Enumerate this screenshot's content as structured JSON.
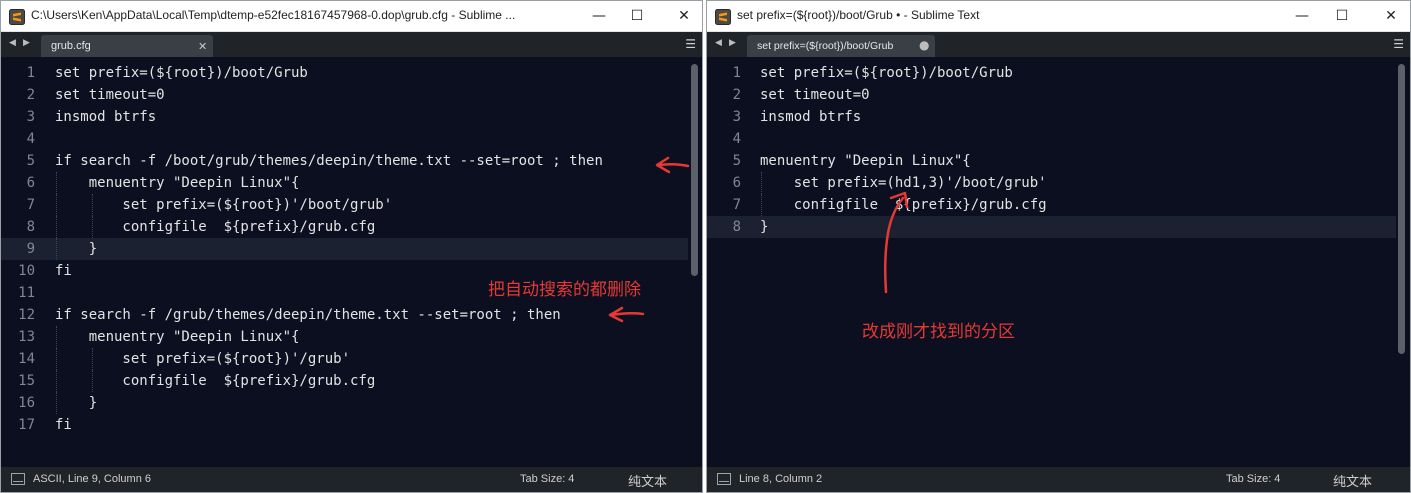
{
  "left_window": {
    "title": "C:\\Users\\Ken\\AppData\\Local\\Temp\\dtemp-e52fec18167457968-0.dop\\grub.cfg - Sublime ...",
    "tab_label": "grub.cfg",
    "lines": [
      {
        "num": "1",
        "text": "set prefix=(${root})/boot/Grub"
      },
      {
        "num": "2",
        "text": "set timeout=0"
      },
      {
        "num": "3",
        "text": "insmod btrfs"
      },
      {
        "num": "4",
        "text": ""
      },
      {
        "num": "5",
        "text": "if search -f /boot/grub/themes/deepin/theme.txt --set=root ; then"
      },
      {
        "num": "6",
        "text": "    menuentry \"Deepin Linux\"{"
      },
      {
        "num": "7",
        "text": "        set prefix=(${root})'/boot/grub'"
      },
      {
        "num": "8",
        "text": "        configfile  ${prefix}/grub.cfg"
      },
      {
        "num": "9",
        "text": "    }"
      },
      {
        "num": "10",
        "text": "fi"
      },
      {
        "num": "11",
        "text": ""
      },
      {
        "num": "12",
        "text": "if search -f /grub/themes/deepin/theme.txt --set=root ; then"
      },
      {
        "num": "13",
        "text": "    menuentry \"Deepin Linux\"{"
      },
      {
        "num": "14",
        "text": "        set prefix=(${root})'/grub'"
      },
      {
        "num": "15",
        "text": "        configfile  ${prefix}/grub.cfg"
      },
      {
        "num": "16",
        "text": "    }"
      },
      {
        "num": "17",
        "text": "fi"
      }
    ],
    "status": {
      "position": "ASCII, Line 9, Column 6",
      "tab_size": "Tab Size: 4",
      "syntax": "纯文本"
    },
    "annotation": "把自动搜索的都删除"
  },
  "right_window": {
    "title": "set prefix=(${root})/boot/Grub • - Sublime Text",
    "tab_label": "set prefix=(${root})/boot/Grub",
    "tab_dirty": "●",
    "lines": [
      {
        "num": "1",
        "text": "set prefix=(${root})/boot/Grub"
      },
      {
        "num": "2",
        "text": "set timeout=0"
      },
      {
        "num": "3",
        "text": "insmod btrfs"
      },
      {
        "num": "4",
        "text": ""
      },
      {
        "num": "5",
        "text": "menuentry \"Deepin Linux\"{"
      },
      {
        "num": "6",
        "text": "    set prefix=(hd1,3)'/boot/grub'"
      },
      {
        "num": "7",
        "text": "    configfile  ${prefix}/grub.cfg"
      },
      {
        "num": "8",
        "text": "}"
      }
    ],
    "status": {
      "position": "Line 8, Column 2",
      "tab_size": "Tab Size: 4",
      "syntax": "纯文本"
    },
    "annotation": "改成刚才找到的分区"
  },
  "colors": {
    "editor_bg": "#0b0f1f",
    "text": "#e3e3e3",
    "annotation_red": "#e53935"
  }
}
